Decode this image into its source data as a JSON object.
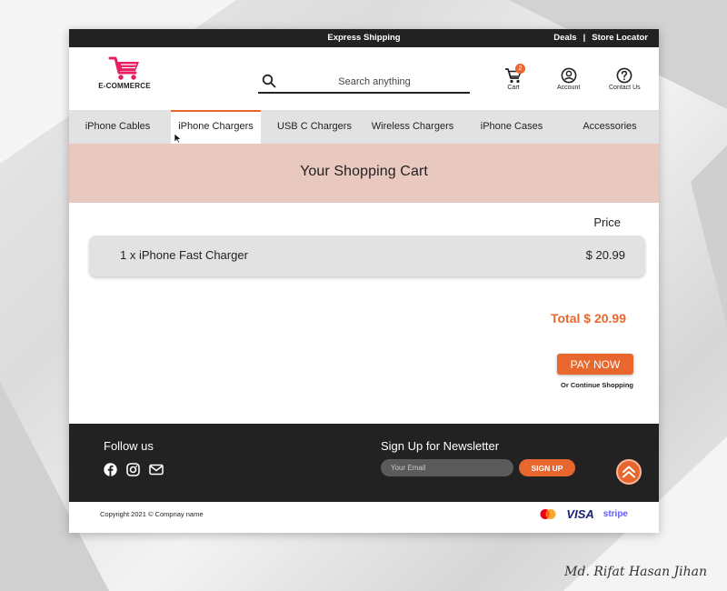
{
  "topbar": {
    "center_text": "Express Shipping",
    "deals": "Deals",
    "separator": "|",
    "store_locator": "Store Locator"
  },
  "logo": {
    "text": "E-COMMERCE",
    "icon": "shopping-cart-logo",
    "color": "#e91e63"
  },
  "search": {
    "placeholder": "Search anything",
    "value": "",
    "icon": "search-icon"
  },
  "header_icons": {
    "cart": {
      "label": "Cart",
      "count": "2",
      "icon": "cart-icon"
    },
    "account": {
      "label": "Account",
      "icon": "account-icon"
    },
    "contact": {
      "label": "Contact Us",
      "icon": "help-icon"
    }
  },
  "nav": {
    "items": [
      {
        "label": "iPhone Cables"
      },
      {
        "label": "iPhone Chargers",
        "active": true
      },
      {
        "label": "USB C Chargers"
      },
      {
        "label": "Wireless Chargers"
      },
      {
        "label": "iPhone Cases"
      },
      {
        "label": "Accessories"
      }
    ]
  },
  "banner": {
    "title": "Your Shopping Cart"
  },
  "cart": {
    "price_header": "Price",
    "items": [
      {
        "name": "1 x iPhone Fast Charger",
        "price": "$ 20.99"
      }
    ],
    "total": "Total $ 20.99",
    "pay_label": "PAY NOW",
    "continue_label": "Or Continue Shopping"
  },
  "footer": {
    "follow_title": "Follow us",
    "social_icons": [
      "facebook-icon",
      "instagram-icon",
      "mail-icon"
    ],
    "newsletter_title": "Sign Up for Newsletter",
    "email_placeholder": "Your Email",
    "signup_label": "SIGN UP",
    "scroll_top_icon": "double-chevron-up-icon"
  },
  "bottombar": {
    "copyright": "Copyright 2021 © Compnay name",
    "payments": {
      "visa": "VISA",
      "stripe": "stripe",
      "mastercard": "mastercard-icon"
    }
  },
  "signature": "Md. Rifat Hasan Jihan",
  "colors": {
    "accent": "#e8672e",
    "dark": "#222222",
    "banner": "#e9c9bf",
    "nav": "#e2e2e2"
  }
}
